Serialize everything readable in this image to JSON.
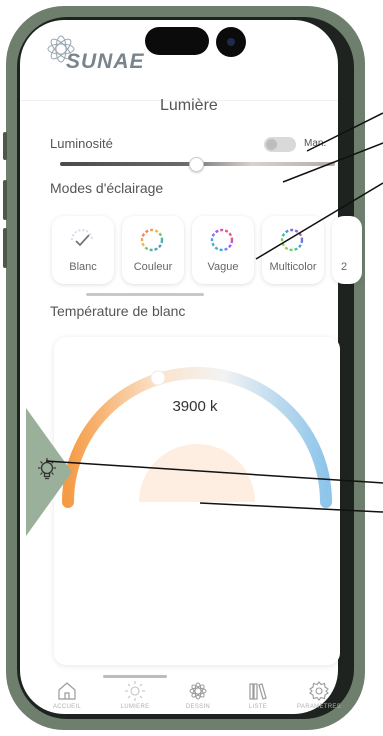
{
  "header": {
    "logo_text": "SUNAE"
  },
  "page_title": "Lumière",
  "brightness": {
    "label": "Luminosité",
    "toggle_label": "Man.",
    "toggle_on": false,
    "level": 0.5
  },
  "modes": {
    "label": "Modes d'éclairage",
    "items": [
      {
        "label": "Blanc",
        "icon": "check-icon"
      },
      {
        "label": "Couleur",
        "icon": "color-ring-icon"
      },
      {
        "label": "Vague",
        "icon": "color-ring-icon"
      },
      {
        "label": "Multicolor",
        "icon": "color-ring-icon"
      },
      {
        "label": "2"
      }
    ]
  },
  "temperature": {
    "label": "Température de blanc",
    "value": "3900 k"
  },
  "tabbar": {
    "items": [
      {
        "label": "ACCUEIL",
        "icon": "home-icon"
      },
      {
        "label": "LUMIERE",
        "icon": "sun-icon",
        "selected": true
      },
      {
        "label": "DESSIN",
        "icon": "flower-icon"
      },
      {
        "label": "LISTE",
        "icon": "books-icon"
      },
      {
        "label": "PARAMETRES",
        "icon": "gear-icon"
      }
    ]
  },
  "colors": {
    "frame": "#6f7f6d",
    "arc_warm": "#f59b45",
    "arc_cool": "#8ec5ea",
    "indicator": "#9bb09a"
  }
}
